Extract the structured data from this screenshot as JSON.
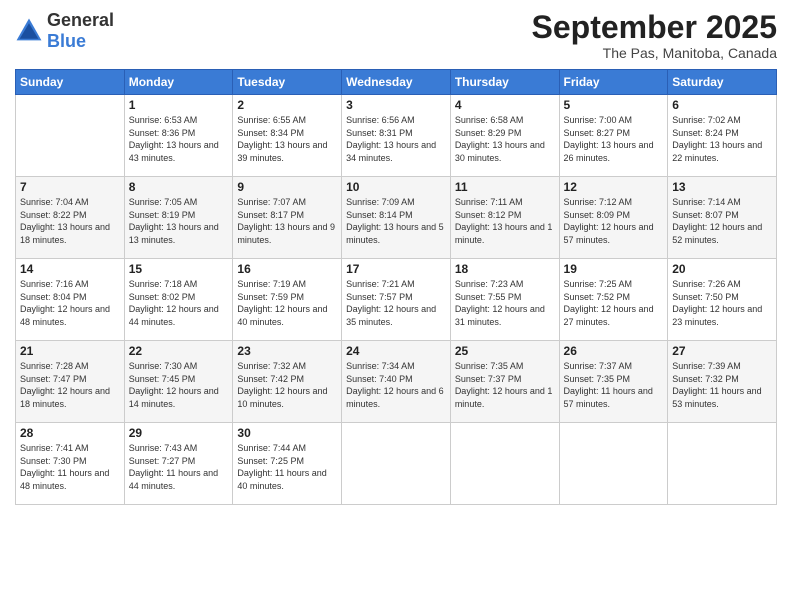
{
  "logo": {
    "general": "General",
    "blue": "Blue"
  },
  "title": "September 2025",
  "location": "The Pas, Manitoba, Canada",
  "days_of_week": [
    "Sunday",
    "Monday",
    "Tuesday",
    "Wednesday",
    "Thursday",
    "Friday",
    "Saturday"
  ],
  "weeks": [
    [
      {
        "day": "",
        "sunrise": "",
        "sunset": "",
        "daylight": ""
      },
      {
        "day": "1",
        "sunrise": "Sunrise: 6:53 AM",
        "sunset": "Sunset: 8:36 PM",
        "daylight": "Daylight: 13 hours and 43 minutes."
      },
      {
        "day": "2",
        "sunrise": "Sunrise: 6:55 AM",
        "sunset": "Sunset: 8:34 PM",
        "daylight": "Daylight: 13 hours and 39 minutes."
      },
      {
        "day": "3",
        "sunrise": "Sunrise: 6:56 AM",
        "sunset": "Sunset: 8:31 PM",
        "daylight": "Daylight: 13 hours and 34 minutes."
      },
      {
        "day": "4",
        "sunrise": "Sunrise: 6:58 AM",
        "sunset": "Sunset: 8:29 PM",
        "daylight": "Daylight: 13 hours and 30 minutes."
      },
      {
        "day": "5",
        "sunrise": "Sunrise: 7:00 AM",
        "sunset": "Sunset: 8:27 PM",
        "daylight": "Daylight: 13 hours and 26 minutes."
      },
      {
        "day": "6",
        "sunrise": "Sunrise: 7:02 AM",
        "sunset": "Sunset: 8:24 PM",
        "daylight": "Daylight: 13 hours and 22 minutes."
      }
    ],
    [
      {
        "day": "7",
        "sunrise": "Sunrise: 7:04 AM",
        "sunset": "Sunset: 8:22 PM",
        "daylight": "Daylight: 13 hours and 18 minutes."
      },
      {
        "day": "8",
        "sunrise": "Sunrise: 7:05 AM",
        "sunset": "Sunset: 8:19 PM",
        "daylight": "Daylight: 13 hours and 13 minutes."
      },
      {
        "day": "9",
        "sunrise": "Sunrise: 7:07 AM",
        "sunset": "Sunset: 8:17 PM",
        "daylight": "Daylight: 13 hours and 9 minutes."
      },
      {
        "day": "10",
        "sunrise": "Sunrise: 7:09 AM",
        "sunset": "Sunset: 8:14 PM",
        "daylight": "Daylight: 13 hours and 5 minutes."
      },
      {
        "day": "11",
        "sunrise": "Sunrise: 7:11 AM",
        "sunset": "Sunset: 8:12 PM",
        "daylight": "Daylight: 13 hours and 1 minute."
      },
      {
        "day": "12",
        "sunrise": "Sunrise: 7:12 AM",
        "sunset": "Sunset: 8:09 PM",
        "daylight": "Daylight: 12 hours and 57 minutes."
      },
      {
        "day": "13",
        "sunrise": "Sunrise: 7:14 AM",
        "sunset": "Sunset: 8:07 PM",
        "daylight": "Daylight: 12 hours and 52 minutes."
      }
    ],
    [
      {
        "day": "14",
        "sunrise": "Sunrise: 7:16 AM",
        "sunset": "Sunset: 8:04 PM",
        "daylight": "Daylight: 12 hours and 48 minutes."
      },
      {
        "day": "15",
        "sunrise": "Sunrise: 7:18 AM",
        "sunset": "Sunset: 8:02 PM",
        "daylight": "Daylight: 12 hours and 44 minutes."
      },
      {
        "day": "16",
        "sunrise": "Sunrise: 7:19 AM",
        "sunset": "Sunset: 7:59 PM",
        "daylight": "Daylight: 12 hours and 40 minutes."
      },
      {
        "day": "17",
        "sunrise": "Sunrise: 7:21 AM",
        "sunset": "Sunset: 7:57 PM",
        "daylight": "Daylight: 12 hours and 35 minutes."
      },
      {
        "day": "18",
        "sunrise": "Sunrise: 7:23 AM",
        "sunset": "Sunset: 7:55 PM",
        "daylight": "Daylight: 12 hours and 31 minutes."
      },
      {
        "day": "19",
        "sunrise": "Sunrise: 7:25 AM",
        "sunset": "Sunset: 7:52 PM",
        "daylight": "Daylight: 12 hours and 27 minutes."
      },
      {
        "day": "20",
        "sunrise": "Sunrise: 7:26 AM",
        "sunset": "Sunset: 7:50 PM",
        "daylight": "Daylight: 12 hours and 23 minutes."
      }
    ],
    [
      {
        "day": "21",
        "sunrise": "Sunrise: 7:28 AM",
        "sunset": "Sunset: 7:47 PM",
        "daylight": "Daylight: 12 hours and 18 minutes."
      },
      {
        "day": "22",
        "sunrise": "Sunrise: 7:30 AM",
        "sunset": "Sunset: 7:45 PM",
        "daylight": "Daylight: 12 hours and 14 minutes."
      },
      {
        "day": "23",
        "sunrise": "Sunrise: 7:32 AM",
        "sunset": "Sunset: 7:42 PM",
        "daylight": "Daylight: 12 hours and 10 minutes."
      },
      {
        "day": "24",
        "sunrise": "Sunrise: 7:34 AM",
        "sunset": "Sunset: 7:40 PM",
        "daylight": "Daylight: 12 hours and 6 minutes."
      },
      {
        "day": "25",
        "sunrise": "Sunrise: 7:35 AM",
        "sunset": "Sunset: 7:37 PM",
        "daylight": "Daylight: 12 hours and 1 minute."
      },
      {
        "day": "26",
        "sunrise": "Sunrise: 7:37 AM",
        "sunset": "Sunset: 7:35 PM",
        "daylight": "Daylight: 11 hours and 57 minutes."
      },
      {
        "day": "27",
        "sunrise": "Sunrise: 7:39 AM",
        "sunset": "Sunset: 7:32 PM",
        "daylight": "Daylight: 11 hours and 53 minutes."
      }
    ],
    [
      {
        "day": "28",
        "sunrise": "Sunrise: 7:41 AM",
        "sunset": "Sunset: 7:30 PM",
        "daylight": "Daylight: 11 hours and 48 minutes."
      },
      {
        "day": "29",
        "sunrise": "Sunrise: 7:43 AM",
        "sunset": "Sunset: 7:27 PM",
        "daylight": "Daylight: 11 hours and 44 minutes."
      },
      {
        "day": "30",
        "sunrise": "Sunrise: 7:44 AM",
        "sunset": "Sunset: 7:25 PM",
        "daylight": "Daylight: 11 hours and 40 minutes."
      },
      {
        "day": "",
        "sunrise": "",
        "sunset": "",
        "daylight": ""
      },
      {
        "day": "",
        "sunrise": "",
        "sunset": "",
        "daylight": ""
      },
      {
        "day": "",
        "sunrise": "",
        "sunset": "",
        "daylight": ""
      },
      {
        "day": "",
        "sunrise": "",
        "sunset": "",
        "daylight": ""
      }
    ]
  ]
}
